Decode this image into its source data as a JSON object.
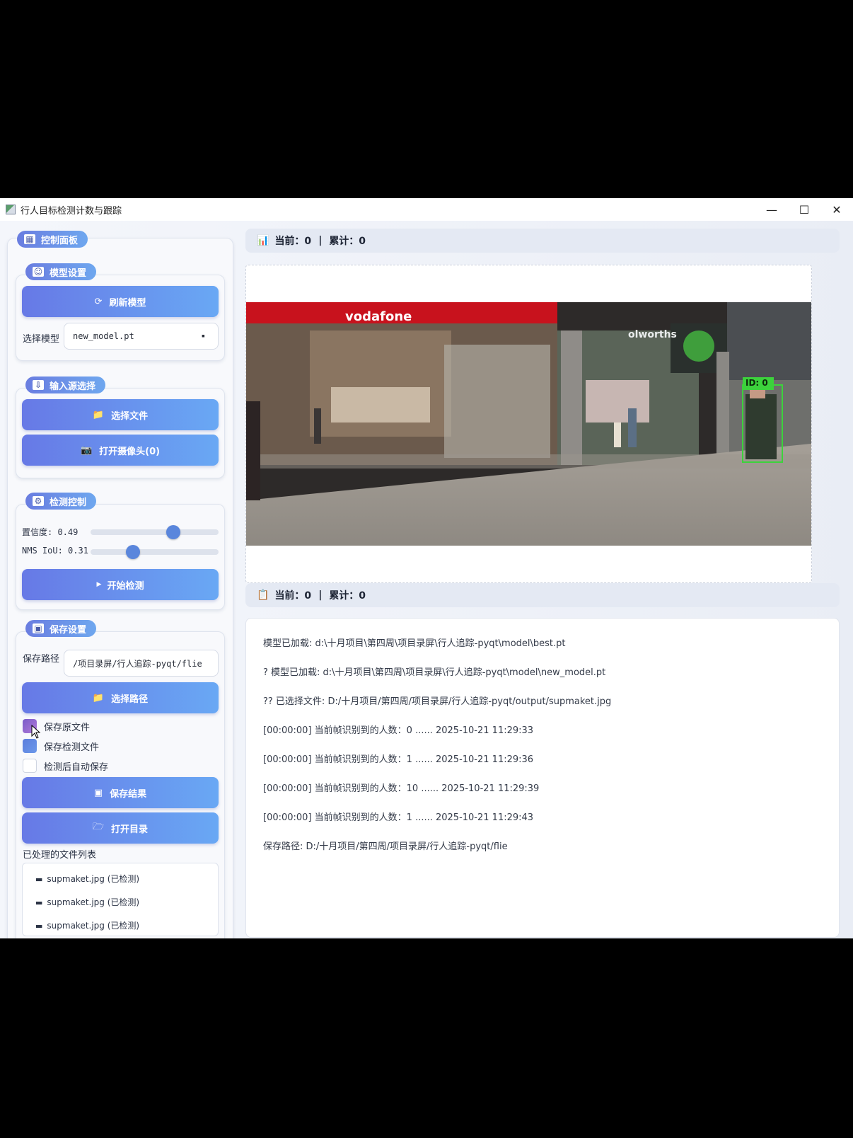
{
  "window": {
    "title": "行人目标检测计数与跟踪",
    "controls": {
      "minimize": "—",
      "maximize": "☐",
      "close": "✕"
    }
  },
  "control_panel": {
    "title": "控制面板",
    "icon": "dashboard-icon"
  },
  "model_settings": {
    "title": "模型设置",
    "refresh_button": "刷新模型",
    "select_label": "选择模型",
    "selected_model": "new_model.pt"
  },
  "input_source": {
    "title": "输入源选择",
    "select_file_button": "选择文件",
    "open_camera_button": "打开摄像头(0)"
  },
  "detection_control": {
    "title": "检测控制",
    "confidence_label": "置信度: 0.49",
    "confidence_value": 0.49,
    "nms_label": "NMS IoU: 0.31",
    "nms_value": 0.31,
    "start_button": "开始检测",
    "start_icon": "▶"
  },
  "save_settings": {
    "title": "保存设置",
    "path_label": "保存路径",
    "path_value": "/项目录屏/行人追踪-pyqt/flie",
    "select_path_button": "选择路径",
    "checkboxes": [
      {
        "label": "保存原文件",
        "checked": true
      },
      {
        "label": "保存检测文件",
        "checked": true
      },
      {
        "label": "检测后自动保存",
        "checked": false
      }
    ],
    "save_results_button": "保存结果",
    "open_dir_button": "打开目录",
    "processed_list_label": "已处理的文件列表",
    "processed_files": [
      "supmaket.jpg (已检测)",
      "supmaket.jpg (已检测)",
      "supmaket.jpg (已检测)"
    ]
  },
  "stats_top": {
    "current_label": "当前：0",
    "separator": "|",
    "total_label": "累计：0"
  },
  "stats_bottom": {
    "current_label": "当前：0",
    "separator": "|",
    "total_label": "累计：0"
  },
  "video": {
    "store_sign": "vodafone",
    "store_sign2": "olworths",
    "detection_label": "ID: 0"
  },
  "log": [
    "模型已加载: d:\\十月项目\\第四周\\项目录屏\\行人追踪-pyqt\\model\\best.pt",
    "? 模型已加载: d:\\十月项目\\第四周\\项目录屏\\行人追踪-pyqt\\model\\new_model.pt",
    "?? 已选择文件: D:/十月项目/第四周/项目录屏/行人追踪-pyqt/output/supmaket.jpg",
    "[00:00:00] 当前帧识别到的人数：0 ...... 2025-10-21 11:29:33",
    "[00:00:00] 当前帧识别到的人数：1 ...... 2025-10-21 11:29:36",
    "[00:00:00] 当前帧识别到的人数：10 ...... 2025-10-21 11:29:39",
    "[00:00:00] 当前帧识别到的人数：1 ...... 2025-10-21 11:29:43",
    "保存路径: D:/十月项目/第四周/项目录屏/行人追踪-pyqt/flie"
  ],
  "colors": {
    "accent_start": "#6779e6",
    "accent_end": "#69a8f4",
    "detection_box": "#3cd23c"
  }
}
